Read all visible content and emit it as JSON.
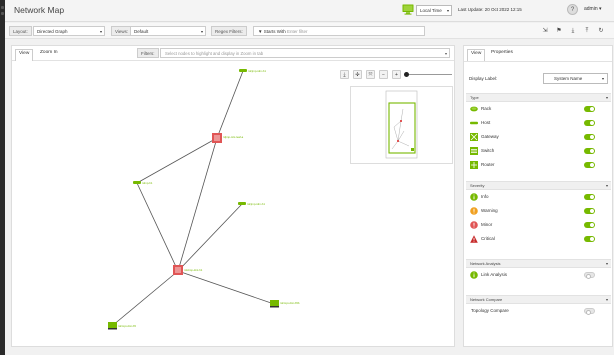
{
  "header": {
    "title": "Network Map",
    "time_select": "Local Time",
    "last_update": "Last Update: 20 Oct 2022 12:15",
    "user": "admin"
  },
  "filter_bar": {
    "layout_label": "Layout:",
    "layout_value": "Directed Graph",
    "views_label": "Views:",
    "views_value": "Default",
    "regex_label": "Regex Filters:",
    "regex_mode": "Starts With",
    "regex_placeholder": "Enter filter"
  },
  "main": {
    "tabs": [
      "View",
      "Zoom In"
    ],
    "filters_label": "Filters:",
    "filters_placeholder": "Select nodes to highlight and display in Zoom in tab",
    "nodes": [
      {
        "type": "host",
        "label": "rdcjmp-idm-h1"
      },
      {
        "type": "switch",
        "label": "rdjmp-mlx-leaf-a"
      },
      {
        "type": "host",
        "label": "rdmp-h1"
      },
      {
        "type": "host",
        "label": "rdcjmp-idm-h1"
      },
      {
        "type": "switch",
        "label": "mlcimp-dmi-h1"
      },
      {
        "type": "gateway",
        "label": "rdcmpi-dmi-h5b"
      },
      {
        "type": "gateway",
        "label": "rdcmpi-dmi-h5"
      }
    ]
  },
  "right_panel": {
    "tabs": [
      "View",
      "Properties"
    ],
    "display_label_title": "Display Label:",
    "display_label_value": "System Name",
    "sections": [
      {
        "title": "Type",
        "items": [
          {
            "label": "Rack",
            "icon": "rack-icon",
            "on": true
          },
          {
            "label": "Host",
            "icon": "host-icon",
            "on": true
          },
          {
            "label": "Gateway",
            "icon": "gateway-icon",
            "on": true
          },
          {
            "label": "Switch",
            "icon": "switch-icon",
            "on": true
          },
          {
            "label": "Router",
            "icon": "router-icon",
            "on": true
          }
        ]
      },
      {
        "title": "Severity",
        "items": [
          {
            "label": "Info",
            "icon": "info-icon",
            "on": true
          },
          {
            "label": "Warning",
            "icon": "warning-icon",
            "on": true
          },
          {
            "label": "Minor",
            "icon": "minor-icon",
            "on": true
          },
          {
            "label": "Critical",
            "icon": "critical-icon",
            "on": true
          }
        ]
      },
      {
        "title": "Network Analysis",
        "items": [
          {
            "label": "Link Analysis",
            "icon": "link-analysis-icon",
            "on": false
          }
        ]
      },
      {
        "title": "Network Compare",
        "items": [
          {
            "label": "Topology Compare",
            "icon": "",
            "on": false
          }
        ]
      }
    ]
  },
  "colors": {
    "accent": "#76b900",
    "switch": "#e05555",
    "info": "#76b900",
    "warning": "#f0a020",
    "minor": "#e05555",
    "critical": "#c62828"
  }
}
